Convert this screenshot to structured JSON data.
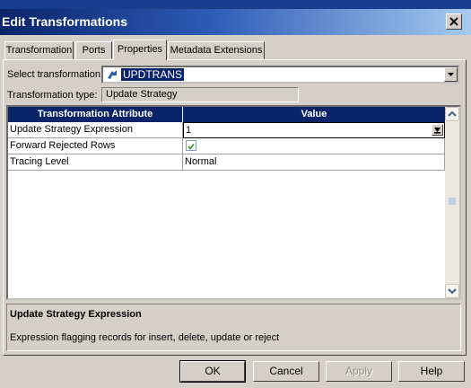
{
  "window": {
    "title": "Edit Transformations"
  },
  "tabs": [
    {
      "label": "Transformation"
    },
    {
      "label": "Ports"
    },
    {
      "label": "Properties",
      "active": true
    },
    {
      "label": "Metadata Extensions"
    }
  ],
  "form": {
    "select_label": "Select transformation:",
    "select_value": "UPDTRANS",
    "type_label": "Transformation type:",
    "type_value": "Update Strategy"
  },
  "grid": {
    "columns": [
      "Transformation Attribute",
      "Value"
    ],
    "rows": [
      {
        "attribute": "Update Strategy Expression",
        "value": "1"
      },
      {
        "attribute": "Forward Rejected Rows",
        "value": "",
        "checked": true
      },
      {
        "attribute": "Tracing Level",
        "value": "Normal"
      }
    ]
  },
  "description": {
    "title": "Update Strategy Expression",
    "text": "Expression flagging records for insert, delete, update or reject"
  },
  "buttons": {
    "ok": "OK",
    "cancel": "Cancel",
    "apply": "Apply",
    "help": "Help"
  },
  "colors": {
    "titlebar": "#0a246a",
    "face": "#d4d0c8",
    "selection": "#0a246a"
  },
  "icons": [
    "close-icon",
    "transformation-icon",
    "dropdown-arrow-icon",
    "expression-editor-icon",
    "checkbox-checked-icon",
    "scroll-up-icon",
    "scroll-down-icon"
  ]
}
